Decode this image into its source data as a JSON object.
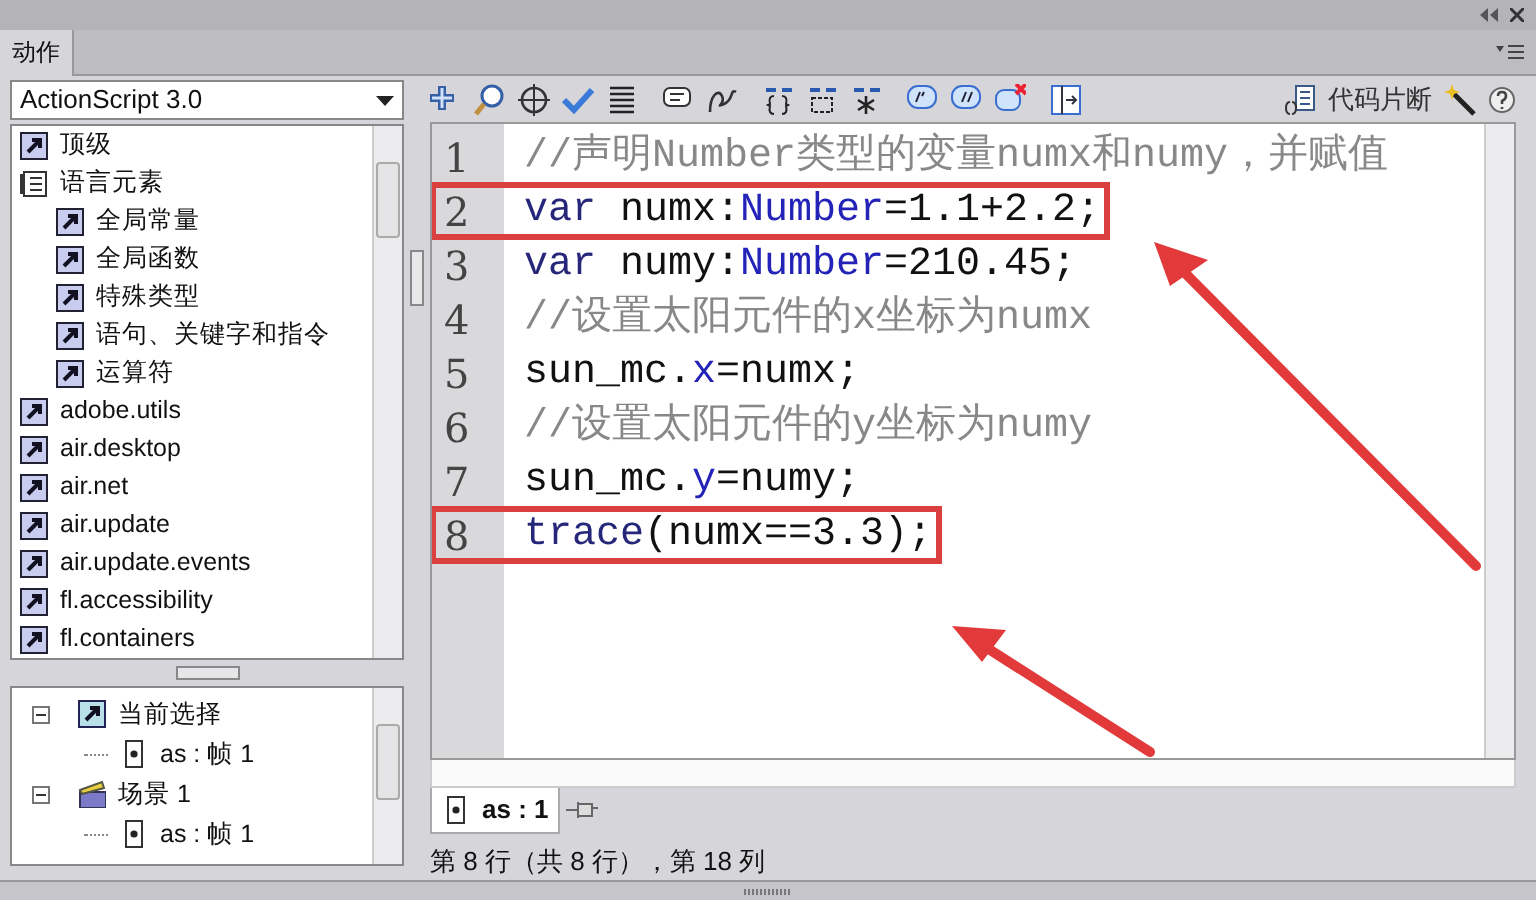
{
  "panel": {
    "title": "动作"
  },
  "language_select": {
    "value": "ActionScript 3.0"
  },
  "toolbox": [
    {
      "label": "顶级",
      "kind": "class"
    },
    {
      "label": "语言元素",
      "kind": "book",
      "children": [
        {
          "label": "全局常量",
          "kind": "class"
        },
        {
          "label": "全局函数",
          "kind": "class"
        },
        {
          "label": "特殊类型",
          "kind": "class"
        },
        {
          "label": "语句、关键字和指令",
          "kind": "class"
        },
        {
          "label": "运算符",
          "kind": "class"
        }
      ]
    },
    {
      "label": "adobe.utils",
      "kind": "class"
    },
    {
      "label": "air.desktop",
      "kind": "class"
    },
    {
      "label": "air.net",
      "kind": "class"
    },
    {
      "label": "air.update",
      "kind": "class"
    },
    {
      "label": "air.update.events",
      "kind": "class"
    },
    {
      "label": "fl.accessibility",
      "kind": "class"
    },
    {
      "label": "fl.containers",
      "kind": "class"
    }
  ],
  "script_navigator": [
    {
      "label": "当前选择",
      "kind": "selection",
      "expanded": true,
      "children": [
        {
          "label": "as : 帧 1",
          "kind": "script"
        }
      ]
    },
    {
      "label": "场景 1",
      "kind": "scene",
      "expanded": true,
      "children": [
        {
          "label": "as : 帧 1",
          "kind": "script"
        }
      ]
    }
  ],
  "toolbar": {
    "code_snippets": "代码片断"
  },
  "code_lines": [
    {
      "number": "1",
      "highlighted": false,
      "tokens": [
        {
          "text": "//声明Number类型的变量numx和numy，并赋值",
          "kind": "comment"
        }
      ]
    },
    {
      "number": "2",
      "highlighted": true,
      "tokens": [
        {
          "text": "var",
          "kind": "keyword"
        },
        {
          "text": " numx:",
          "kind": "plain"
        },
        {
          "text": "Number",
          "kind": "type"
        },
        {
          "text": "=1.1+2.2;",
          "kind": "plain"
        }
      ]
    },
    {
      "number": "3",
      "highlighted": false,
      "tokens": [
        {
          "text": "var",
          "kind": "keyword"
        },
        {
          "text": " numy:",
          "kind": "plain"
        },
        {
          "text": "Number",
          "kind": "type"
        },
        {
          "text": "=210.45;",
          "kind": "plain"
        }
      ]
    },
    {
      "number": "4",
      "highlighted": false,
      "tokens": [
        {
          "text": "//设置太阳元件的x坐标为numx",
          "kind": "comment"
        }
      ]
    },
    {
      "number": "5",
      "highlighted": false,
      "tokens": [
        {
          "text": "sun_mc.",
          "kind": "plain"
        },
        {
          "text": "x",
          "kind": "type"
        },
        {
          "text": "=numx;",
          "kind": "plain"
        }
      ]
    },
    {
      "number": "6",
      "highlighted": false,
      "tokens": [
        {
          "text": "//设置太阳元件的y坐标为numy",
          "kind": "comment"
        }
      ]
    },
    {
      "number": "7",
      "highlighted": false,
      "tokens": [
        {
          "text": "sun_mc.",
          "kind": "plain"
        },
        {
          "text": "y",
          "kind": "type"
        },
        {
          "text": "=numy;",
          "kind": "plain"
        }
      ]
    },
    {
      "number": "8",
      "highlighted": true,
      "tokens": [
        {
          "text": "trace",
          "kind": "keyword"
        },
        {
          "text": "(numx==3.3);",
          "kind": "plain"
        }
      ]
    }
  ],
  "script_tabs": [
    {
      "label": "as : 1",
      "selected": true
    }
  ],
  "status_bar": "第 8 行（共 8 行），第 18 列"
}
